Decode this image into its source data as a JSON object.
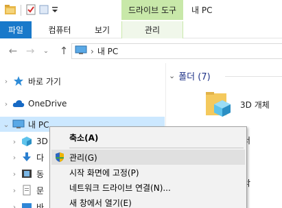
{
  "window": {
    "title": "내 PC",
    "tool_tab_header": "드라이브 도구"
  },
  "ribbon_tabs": {
    "file": "파일",
    "computer": "컴퓨터",
    "view": "보기",
    "manage": "관리"
  },
  "address": {
    "path": "내 PC"
  },
  "nav": {
    "quick_access": "바로 가기",
    "onedrive": "OneDrive",
    "this_pc": "내 PC",
    "child1": "3D",
    "child2": "다",
    "child3": "동",
    "child4": "문",
    "child5": "바"
  },
  "content": {
    "folders_header": "폴더 (7)",
    "folder1": "3D 개체",
    "partial1": "서",
    "partial2": "악"
  },
  "context_menu": {
    "collapse": "축소(A)",
    "manage": "관리(G)",
    "pin_start": "시작 화면에 고정(P)",
    "map_drive": "네트워크 드라이브 연결(N)...",
    "open_new_window": "새 창에서 열기(E)"
  },
  "colors": {
    "file_tab": "#1979ca",
    "tool_tab": "#c8e8a9",
    "selected": "#cce8ff",
    "group_header": "#1e3287"
  }
}
